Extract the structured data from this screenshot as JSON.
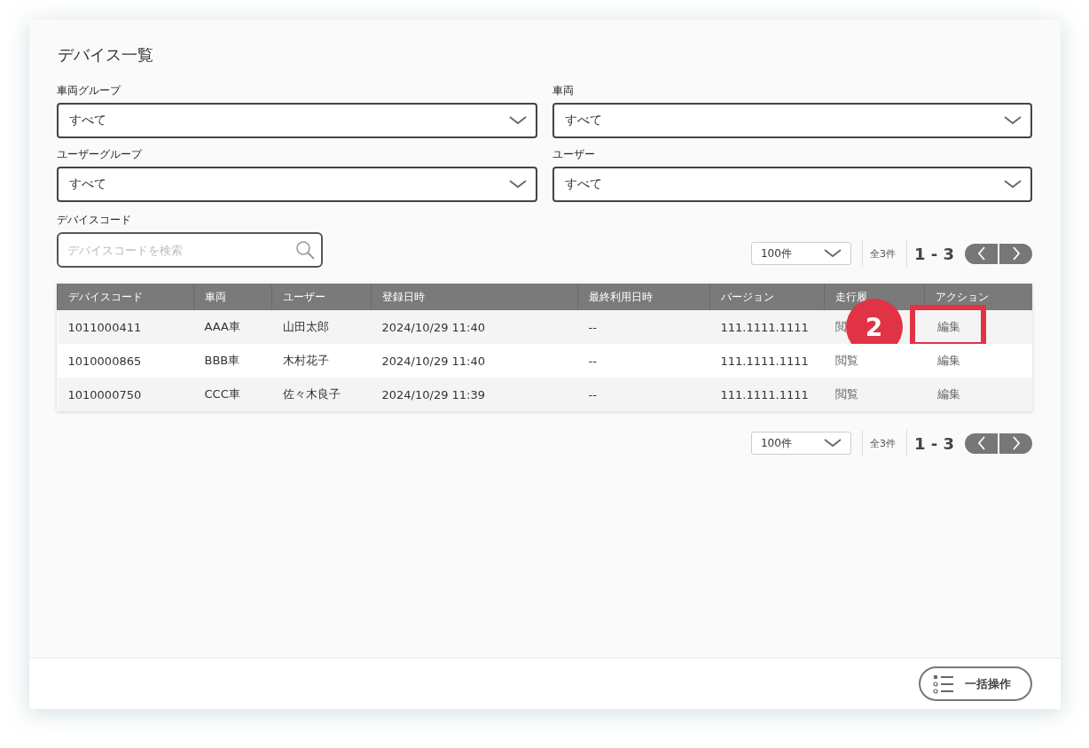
{
  "title": "デバイス一覧",
  "filters": [
    {
      "label": "車両グループ",
      "value": "すべて"
    },
    {
      "label": "車両",
      "value": "すべて"
    },
    {
      "label": "ユーザーグループ",
      "value": "すべて"
    },
    {
      "label": "ユーザー",
      "value": "すべて"
    }
  ],
  "search": {
    "label": "デバイスコード",
    "placeholder": "デバイスコードを検索"
  },
  "pagination": [
    {
      "per_page": "100件",
      "total": "全3件",
      "range": "1 - 3"
    },
    {
      "per_page": "100件",
      "total": "全3件",
      "range": "1 - 3"
    }
  ],
  "table": {
    "columns": [
      "デバイスコード",
      "車両",
      "ユーザー",
      "登録日時",
      "最終利用日時",
      "バージョン",
      "走行履",
      "アクション"
    ],
    "rows": [
      {
        "cells": [
          "1011000411",
          "AAA車",
          "山田太郎",
          "2024/10/29 11:40",
          "--",
          "111.1111.1111",
          "閲",
          "編集"
        ],
        "highlighted": true
      },
      {
        "cells": [
          "1010000865",
          "BBB車",
          "木村花子",
          "2024/10/29 11:40",
          "--",
          "111.1111.1111",
          "閲覧",
          "編集"
        ],
        "highlighted": false
      },
      {
        "cells": [
          "1010000750",
          "CCC車",
          "佐々木良子",
          "2024/10/29 11:39",
          "--",
          "111.1111.1111",
          "閲覧",
          "編集"
        ],
        "highlighted": false
      }
    ]
  },
  "step_badge": "2",
  "bulk_button": "一括操作"
}
